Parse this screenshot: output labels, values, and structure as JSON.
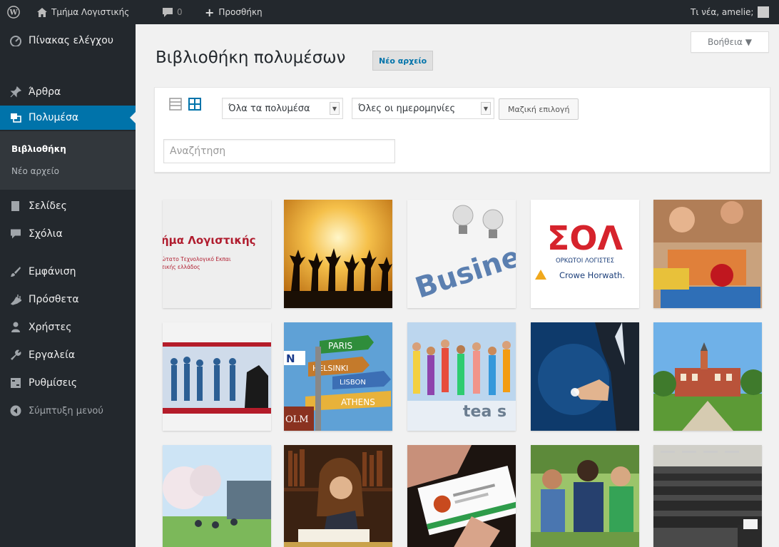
{
  "adminbar": {
    "site_name": "Τμήμα Λογιστικής",
    "comments_count": "0",
    "new_label": "Προσθήκη",
    "greeting": "Τι νέα, amelie;"
  },
  "sidebar": {
    "items": [
      {
        "label": "Πίνακας ελέγχου",
        "icon": "dashboard-icon"
      },
      {
        "label": "Άρθρα",
        "icon": "pin-icon"
      },
      {
        "label": "Πολυμέσα",
        "icon": "media-icon"
      },
      {
        "label": "Σελίδες",
        "icon": "pages-icon"
      },
      {
        "label": "Σχόλια",
        "icon": "comments-icon"
      },
      {
        "label": "Εμφάνιση",
        "icon": "appearance-icon"
      },
      {
        "label": "Πρόσθετα",
        "icon": "plugins-icon"
      },
      {
        "label": "Χρήστες",
        "icon": "users-icon"
      },
      {
        "label": "Εργαλεία",
        "icon": "tools-icon"
      },
      {
        "label": "Ρυθμίσεις",
        "icon": "settings-icon"
      },
      {
        "label": "Σύμπτυξη μενού",
        "icon": "collapse-icon"
      }
    ],
    "submenu": [
      "Βιβλιοθήκη",
      "Νέο αρχείο"
    ]
  },
  "help_tab": "Βοήθεια ▼",
  "page": {
    "title": "Βιβλιοθήκη πολυμέσων",
    "add_new": "Νέο αρχείο"
  },
  "toolbar": {
    "type_filter": "Όλα τα πολυμέσα",
    "date_filter": "Όλες οι ημερομηνίες",
    "bulk_select": "Μαζική επιλογή",
    "search_placeholder": "Αναζήτηση"
  },
  "thumbnails": {
    "logo_line1": "ήμα Λογιστικής",
    "logo_line2": "ώτατο Τεχνολογικό Εκπαι",
    "logo_line3": "τικής ελλάδος",
    "sol_brand": "ΣΟΛ",
    "sol_sub": "ΟΡΚΩΤΟΙ ΛΟΓΙΣΤΕΣ",
    "sol_partner": "Crowe Horwath.",
    "business_word": "Business",
    "sign_paris": "PARIS",
    "sign_helsinki": "HELSINKI",
    "sign_lisbon": "LISBON",
    "sign_athens": "ATHENS",
    "sign_olm": "OLM",
    "sign_n": "N",
    "tea_text": "tea s"
  },
  "colors": {
    "adminbar": "#23282d",
    "sidebar": "#23282d",
    "accent": "#0073aa",
    "background": "#f1f1f1"
  }
}
